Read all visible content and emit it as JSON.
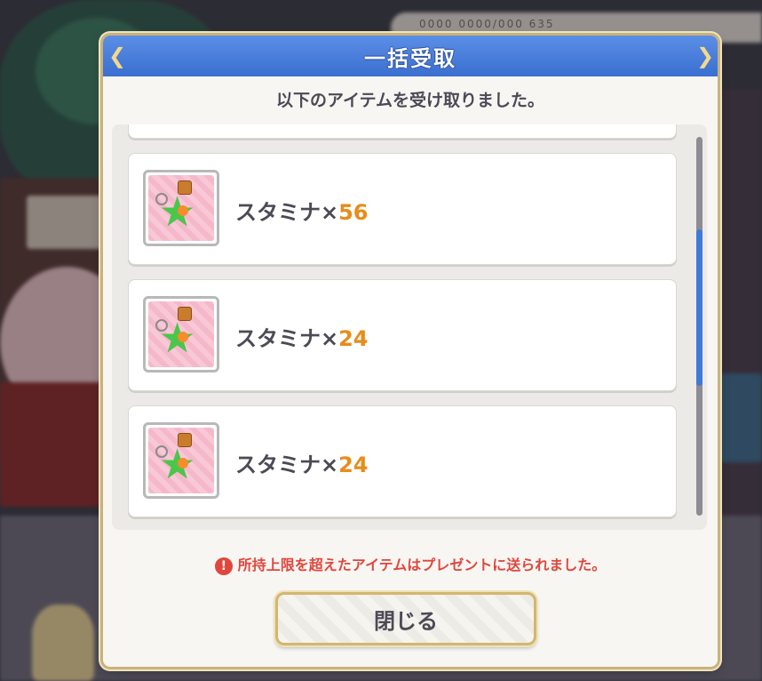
{
  "background": {
    "topbar_text": "0000 0000/000 635"
  },
  "dialog": {
    "title": "一括受取",
    "message": "以下のアイテムを受け取りました。",
    "items": [
      {
        "name": "スタミナ",
        "x": "×",
        "qty": "56",
        "icon": "stamina-potion-icon"
      },
      {
        "name": "スタミナ",
        "x": "×",
        "qty": "24",
        "icon": "stamina-potion-icon"
      },
      {
        "name": "スタミナ",
        "x": "×",
        "qty": "24",
        "icon": "stamina-potion-icon"
      }
    ],
    "notice": "所持上限を超えたアイテムはプレゼントに送られました。",
    "notice_icon": "!",
    "close_label": "閉じる"
  },
  "colors": {
    "title_bar": "#3b6fd0",
    "qty": "#e88c1a",
    "notice": "#e0463c",
    "scroll_thumb": "#3f7ad8"
  }
}
